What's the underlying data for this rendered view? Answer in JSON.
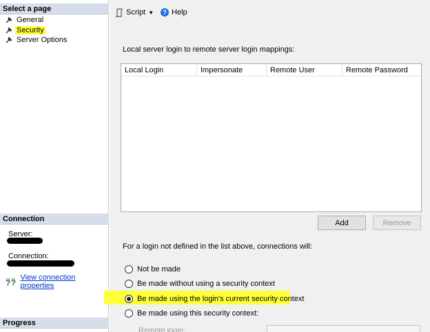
{
  "left_panel": {
    "select_page_header": "Select a page",
    "pages": [
      {
        "label": "General",
        "icon": "wrench-icon",
        "selected": false
      },
      {
        "label": "Security",
        "icon": "wrench-icon",
        "selected": true
      },
      {
        "label": "Server Options",
        "icon": "wrench-icon",
        "selected": false
      }
    ],
    "connection_header": "Connection",
    "server_label": "Server:",
    "connection_label": "Connection:",
    "view_connection_properties": "View connection properties",
    "progress_header": "Progress"
  },
  "toolbar": {
    "script_label": "Script",
    "help_label": "Help"
  },
  "mappings": {
    "label": "Local server login to remote server login mappings:",
    "columns": [
      "Local Login",
      "Impersonate",
      "Remote User",
      "Remote Password"
    ],
    "rows": [],
    "add_label": "Add",
    "remove_label": "Remove"
  },
  "undefined_logins": {
    "label": "For a login not defined in the list above, connections will:",
    "options": [
      {
        "label": "Not be made",
        "selected": false
      },
      {
        "label": "Be made without using a security context",
        "selected": false
      },
      {
        "label": "Be made using the login's current security context",
        "selected": true
      },
      {
        "label": "Be made using this security context:",
        "selected": false
      }
    ],
    "remote_login_label": "Remote login:"
  },
  "colors": {
    "highlight": "#ffff3a",
    "section_header": "#d4dde9",
    "link": "#0033cc"
  }
}
